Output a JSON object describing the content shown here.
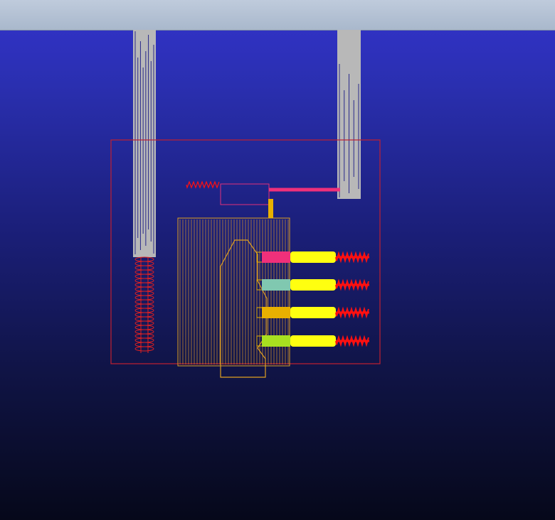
{
  "viewer": {
    "title": "",
    "colors": {
      "background_top": "#3333cc",
      "background_bottom": "#06081a",
      "toolbar": "#b3c1d4",
      "pipe": "#b8b8b8",
      "pipe_lines": "#2a2a8a",
      "boundary": "#c02030",
      "heatsink": "#e0a020",
      "pink": "#f0307a",
      "teal": "#80c8b0",
      "amber": "#e8b000",
      "lime": "#a8e020",
      "yellow": "#ffff10",
      "red": "#ff1010"
    },
    "components": [
      {
        "name": "left-pipe"
      },
      {
        "name": "right-pipe"
      },
      {
        "name": "enclosure-box"
      },
      {
        "name": "heatsink-block"
      },
      {
        "name": "sensor-box"
      },
      {
        "name": "cartridge-row-1",
        "color_key": "pink"
      },
      {
        "name": "cartridge-row-2",
        "color_key": "teal"
      },
      {
        "name": "cartridge-row-3",
        "color_key": "amber"
      },
      {
        "name": "cartridge-row-4",
        "color_key": "lime"
      }
    ]
  }
}
